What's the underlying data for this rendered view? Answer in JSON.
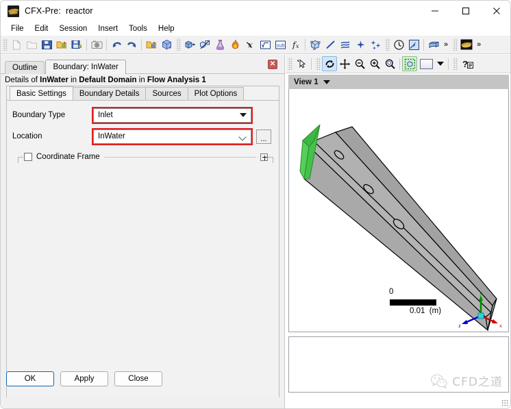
{
  "window": {
    "app_icon": "cfx-logo-icon",
    "title": "CFX-Pre:  reactor",
    "controls": {
      "minimize": "minimize-icon",
      "maximize": "maximize-icon",
      "close": "close-icon"
    }
  },
  "menubar": {
    "items": [
      {
        "label": "File"
      },
      {
        "label": "Edit"
      },
      {
        "label": "Session"
      },
      {
        "label": "Insert"
      },
      {
        "label": "Tools"
      },
      {
        "label": "Help"
      }
    ]
  },
  "toolbar": {
    "groups": [
      {
        "name": "file-group",
        "buttons": [
          {
            "icon": "new-case-icon",
            "enabled": false
          },
          {
            "icon": "open-case-icon",
            "enabled": false
          },
          {
            "icon": "save-case-icon",
            "enabled": true
          },
          {
            "icon": "open-definition-icon",
            "enabled": true
          },
          {
            "icon": "save-definition-icon",
            "enabled": true
          },
          {
            "icon": "snapshot-camera-icon",
            "enabled": true
          },
          {
            "icon": "undo-icon",
            "enabled": true
          },
          {
            "icon": "redo-icon",
            "enabled": true
          },
          {
            "icon": "import-mesh-icon",
            "enabled": true
          },
          {
            "icon": "mesh-cube-icon",
            "enabled": true
          }
        ]
      },
      {
        "name": "physics-group",
        "buttons": [
          {
            "icon": "domain-icon",
            "enabled": true
          },
          {
            "icon": "domain-interface-icon",
            "enabled": true
          },
          {
            "icon": "material-flask-icon",
            "enabled": true
          },
          {
            "icon": "reaction-flame-icon",
            "enabled": true
          },
          {
            "icon": "expression-chi-icon",
            "enabled": true
          },
          {
            "icon": "sqrt-expression-icon",
            "enabled": true
          },
          {
            "icon": "subdomain-icon",
            "enabled": true
          },
          {
            "icon": "user-function-icon",
            "enabled": true
          },
          {
            "icon": "mesh-region-icon",
            "enabled": true
          },
          {
            "icon": "line-icon",
            "enabled": true
          },
          {
            "icon": "contour-icon",
            "enabled": true
          },
          {
            "icon": "point-icon",
            "enabled": true
          },
          {
            "icon": "point-cloud-icon",
            "enabled": true
          }
        ]
      },
      {
        "name": "solver-group",
        "buttons": [
          {
            "icon": "timestep-clock-icon",
            "enabled": true
          },
          {
            "icon": "solver-control-icon",
            "enabled": true
          },
          {
            "icon": "output-box-icon",
            "enabled": true
          }
        ],
        "overflow": "»"
      },
      {
        "name": "launch-group",
        "buttons": [
          {
            "icon": "cfx-solver-launch-icon",
            "enabled": true
          }
        ],
        "overflow": "»"
      }
    ]
  },
  "left_panel": {
    "tabs": [
      {
        "label": "Outline",
        "active": false
      },
      {
        "label": "Boundary: InWater",
        "active": true
      }
    ],
    "close_button": "✕",
    "details": {
      "prefix": "Details of ",
      "object": "InWater",
      "mid1": " in ",
      "domain": "Default Domain",
      "mid2": " in ",
      "analysis": "Flow Analysis 1"
    },
    "subtabs": [
      {
        "label": "Basic Settings",
        "active": true
      },
      {
        "label": "Boundary Details",
        "active": false
      },
      {
        "label": "Sources",
        "active": false
      },
      {
        "label": "Plot Options",
        "active": false
      }
    ],
    "fields": [
      {
        "name": "boundary-type",
        "label": "Boundary Type",
        "value": "Inlet",
        "control": "dropdown",
        "highlighted": true
      },
      {
        "name": "location",
        "label": "Location",
        "value": "InWater",
        "control": "combo-with-browse",
        "browse_label": "...",
        "highlighted": true
      }
    ],
    "coordinate_frame": {
      "label": "Coordinate Frame",
      "checked": false,
      "expander": "+"
    },
    "buttons": [
      {
        "label": "OK",
        "primary": true
      },
      {
        "label": "Apply",
        "primary": false
      },
      {
        "label": "Close",
        "primary": false
      }
    ]
  },
  "viewer": {
    "toolbar": [
      {
        "icon": "select-pointer-icon",
        "active": false
      },
      {
        "icon": "rotate-icon",
        "active": true
      },
      {
        "icon": "pan-icon",
        "active": false
      },
      {
        "icon": "zoom-out-icon",
        "active": false
      },
      {
        "icon": "zoom-in-icon",
        "active": false
      },
      {
        "icon": "zoom-box-icon",
        "active": false
      },
      {
        "icon": "fit-view-icon",
        "active": true
      },
      {
        "icon": "background-color-swatch-icon",
        "active": false
      },
      {
        "icon": "view-dropdown-icon",
        "active": false
      },
      {
        "icon": "help-context-icon",
        "active": false
      }
    ],
    "view_label": "View 1",
    "scale_bar": {
      "min": "0",
      "max": "0.01",
      "unit": "(m)"
    },
    "axes": [
      {
        "name": "x-axis",
        "label": "x",
        "color": "#d00000"
      },
      {
        "name": "y-axis",
        "label": "y",
        "color": "#009000"
      },
      {
        "name": "z-axis",
        "label": "z",
        "color": "#0000d0"
      }
    ],
    "geometry": {
      "name": "reactor-duct",
      "body_color": "#a8a8a8",
      "highlight_color": "#44c24a",
      "edge_color": "#000000"
    }
  },
  "watermark": {
    "text": "CFD之道",
    "logo": "wechat-logo-icon"
  }
}
